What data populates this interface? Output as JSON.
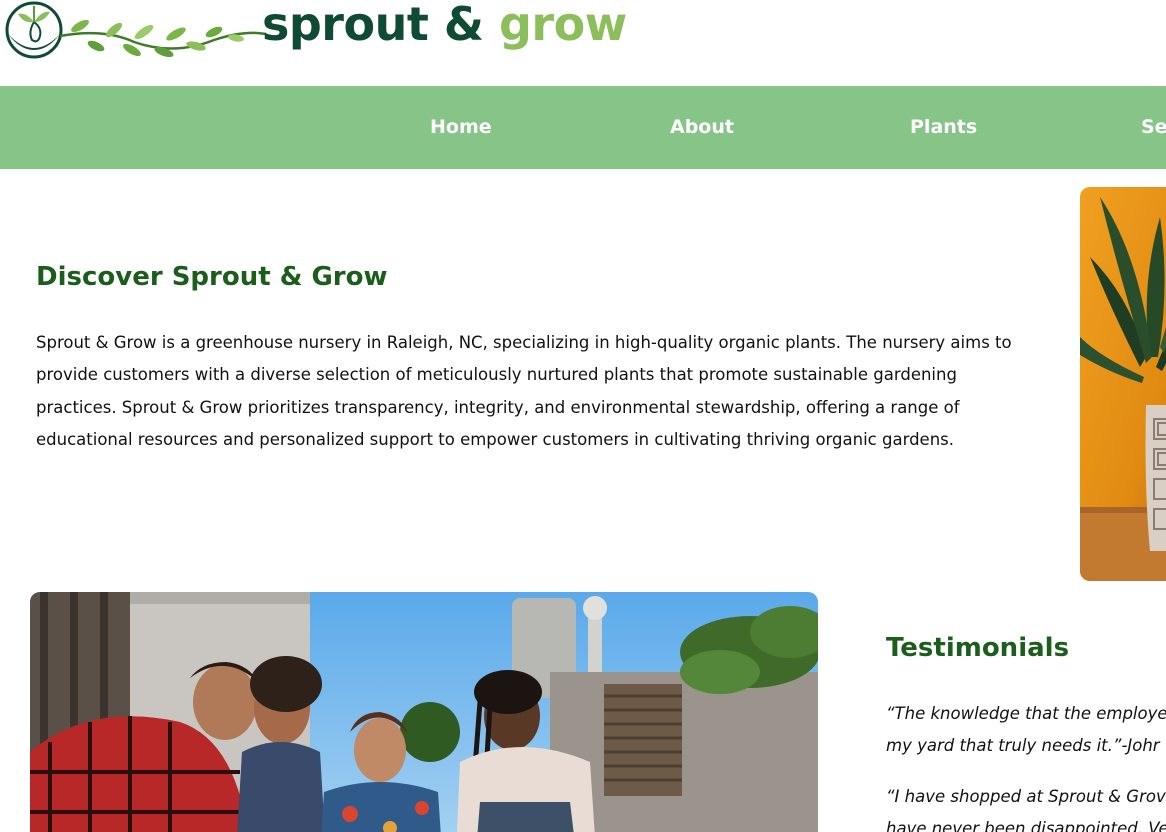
{
  "brand": {
    "word1": "sprout",
    "amp": "&",
    "word2": "grow"
  },
  "nav": {
    "items": [
      {
        "label": "Home"
      },
      {
        "label": "About"
      },
      {
        "label": "Plants"
      },
      {
        "label": "Se"
      }
    ]
  },
  "discover": {
    "title": "Discover Sprout & Grow",
    "body": "Sprout & Grow is a greenhouse nursery in Raleigh, NC, specializing in high-quality organic plants. The nursery aims to provide customers with a diverse selection of meticulously nurtured plants that promote sustainable gardening practices. Sprout & Grow prioritizes transparency, integrity, and environmental stewardship, offering a range of educational resources and personalized support to empower customers in cultivating thriving organic gardens."
  },
  "testimonials": {
    "title": "Testimonials",
    "quotes": [
      {
        "line1": "“The knowledge that the employe",
        "line2": "my yard that truly needs it.”-Johr"
      },
      {
        "line1": "“I have shopped at Sprout & Grov",
        "line2": "have never been disappointed. Ve"
      }
    ]
  },
  "colors": {
    "nav_bg": "#86c587",
    "heading": "#1b5e1b",
    "brand_dark": "#0f4a34",
    "brand_light": "#8cbf5c"
  }
}
